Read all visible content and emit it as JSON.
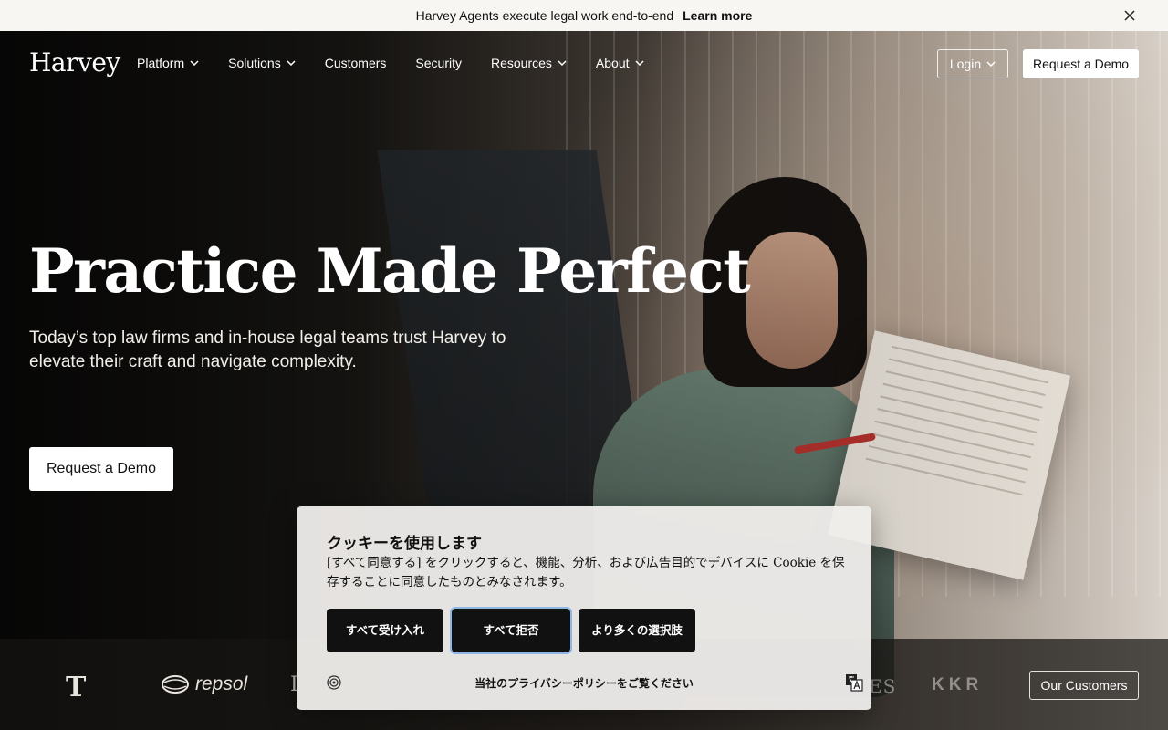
{
  "announcement": {
    "message": "Harvey Agents execute legal work end-to-end",
    "link": "Learn more"
  },
  "nav": {
    "logo": "Harvey",
    "items": [
      {
        "label": "Platform",
        "dropdown": true
      },
      {
        "label": "Solutions",
        "dropdown": true
      },
      {
        "label": "Customers",
        "dropdown": false
      },
      {
        "label": "Security",
        "dropdown": false
      },
      {
        "label": "Resources",
        "dropdown": true
      },
      {
        "label": "About",
        "dropdown": true
      }
    ],
    "login": "Login",
    "demo": "Request a Demo"
  },
  "hero": {
    "title": "Practice Made Perfect",
    "subtitle": "Today’s top law firms and in-house legal teams trust Harvey to elevate their craft and navigate complexity.",
    "cta": "Request a Demo"
  },
  "logos": {
    "items": [
      "T",
      "repsol",
      "I",
      "ES",
      "KKR"
    ],
    "cta": "Our Customers"
  },
  "cookie": {
    "title": "クッキーを使用します",
    "body": "[すべて同意する] をクリックすると、機能、分析、および広告目的でデバイスに Cookie を保存することに同意したものとみなされます。",
    "accept": "すべて受け入れ",
    "reject": "すべて拒否",
    "more": "より多くの選択肢",
    "policy": "当社のプライバシーポリシーをご覧ください"
  },
  "icons": {
    "close": "close-icon",
    "chevron": "chevron-down-icon",
    "cookie_logo": "cookie-settings-icon",
    "language": "language-icon"
  }
}
